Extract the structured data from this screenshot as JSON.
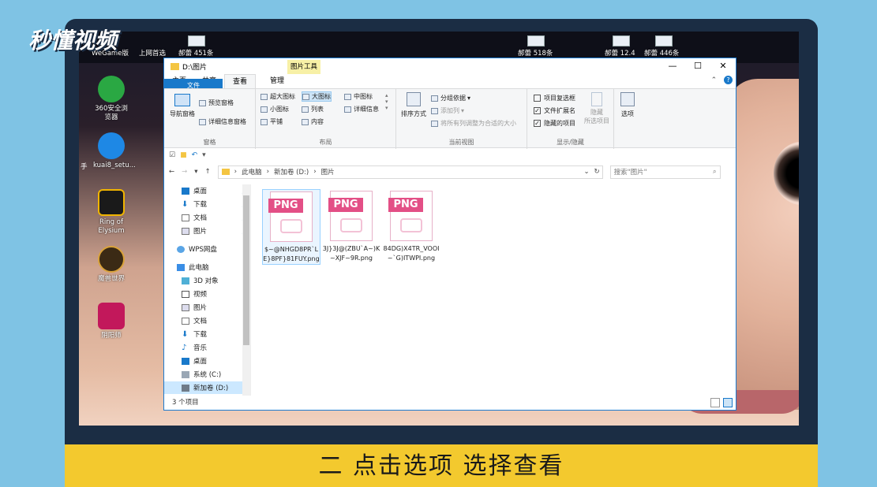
{
  "logo": "秒懂视频",
  "caption": "二 点击选项 选择查看",
  "desktop": {
    "top_labels": [
      "WeGame版",
      "上网首选",
      "郝蕾 451条",
      "郝蕾 518条",
      "郝蕾 12.4",
      "郝蕾 446条"
    ],
    "icons": [
      {
        "label": "360安全浏览器",
        "color": "#2aa843"
      },
      {
        "label": "kuai8_setu...",
        "color": "#1e88e5"
      },
      {
        "label": "Ring of Elysium",
        "color": "#1a1a1a"
      },
      {
        "label": "魔兽世界",
        "color": "#3b2a15"
      },
      {
        "label": "阴阳师",
        "color": "#c2185b"
      }
    ],
    "icon_prefix": "手"
  },
  "window": {
    "title": "D:\\图片",
    "context_tab": "图片工具",
    "buttons": [
      "—",
      "☐",
      "✕"
    ],
    "tabs": [
      "文件",
      "主页",
      "共享",
      "查看",
      "管理"
    ],
    "active_tab": "查看",
    "ribbon": {
      "panes": {
        "nav_pane": "导航窗格",
        "preview_pane": "预览窗格",
        "details_pane": "详细信息窗格",
        "group_label": "窗格"
      },
      "layout": {
        "xl": "超大图标",
        "large": "大图标",
        "medium": "中图标",
        "small": "小图标",
        "list": "列表",
        "details": "详细信息",
        "tiles": "平铺",
        "content": "内容",
        "group_label": "布局"
      },
      "current_view": {
        "sort": "排序方式",
        "group_by": "分组依据",
        "add_columns": "添加列",
        "fit_columns": "将所有列调整为合适的大小",
        "group_label": "当前视图"
      },
      "show_hide": {
        "item_checkboxes": "项目复选框",
        "extensions": "文件扩展名",
        "hidden_items": "隐藏的项目",
        "hide": "隐藏",
        "hide_sub": "所选项目",
        "group_label": "显示/隐藏"
      },
      "options": "选项"
    },
    "address": {
      "path": [
        "此电脑",
        "新加卷 (D:)",
        "图片"
      ],
      "search_placeholder": "搜索\"图片\""
    },
    "nav": {
      "quick": [
        "桌面",
        "下载",
        "文档",
        "图片"
      ],
      "wps": "WPS网盘",
      "this_pc": "此电脑",
      "pc_items": [
        "3D 对象",
        "视频",
        "图片",
        "文档",
        "下载",
        "音乐",
        "桌面",
        "系统 (C:)",
        "新加卷 (D:)"
      ]
    },
    "files": [
      {
        "name": "$~@NHGD8PR`LE}8PF}81FUY.png",
        "badge": "PNG"
      },
      {
        "name": "3J}3J@(ZBU`A~)K~XJF~9R.png",
        "badge": "PNG"
      },
      {
        "name": "84DG)X4TR_VOOI~`G)ITWPI.png",
        "badge": "PNG"
      }
    ],
    "status": "3 个项目"
  }
}
